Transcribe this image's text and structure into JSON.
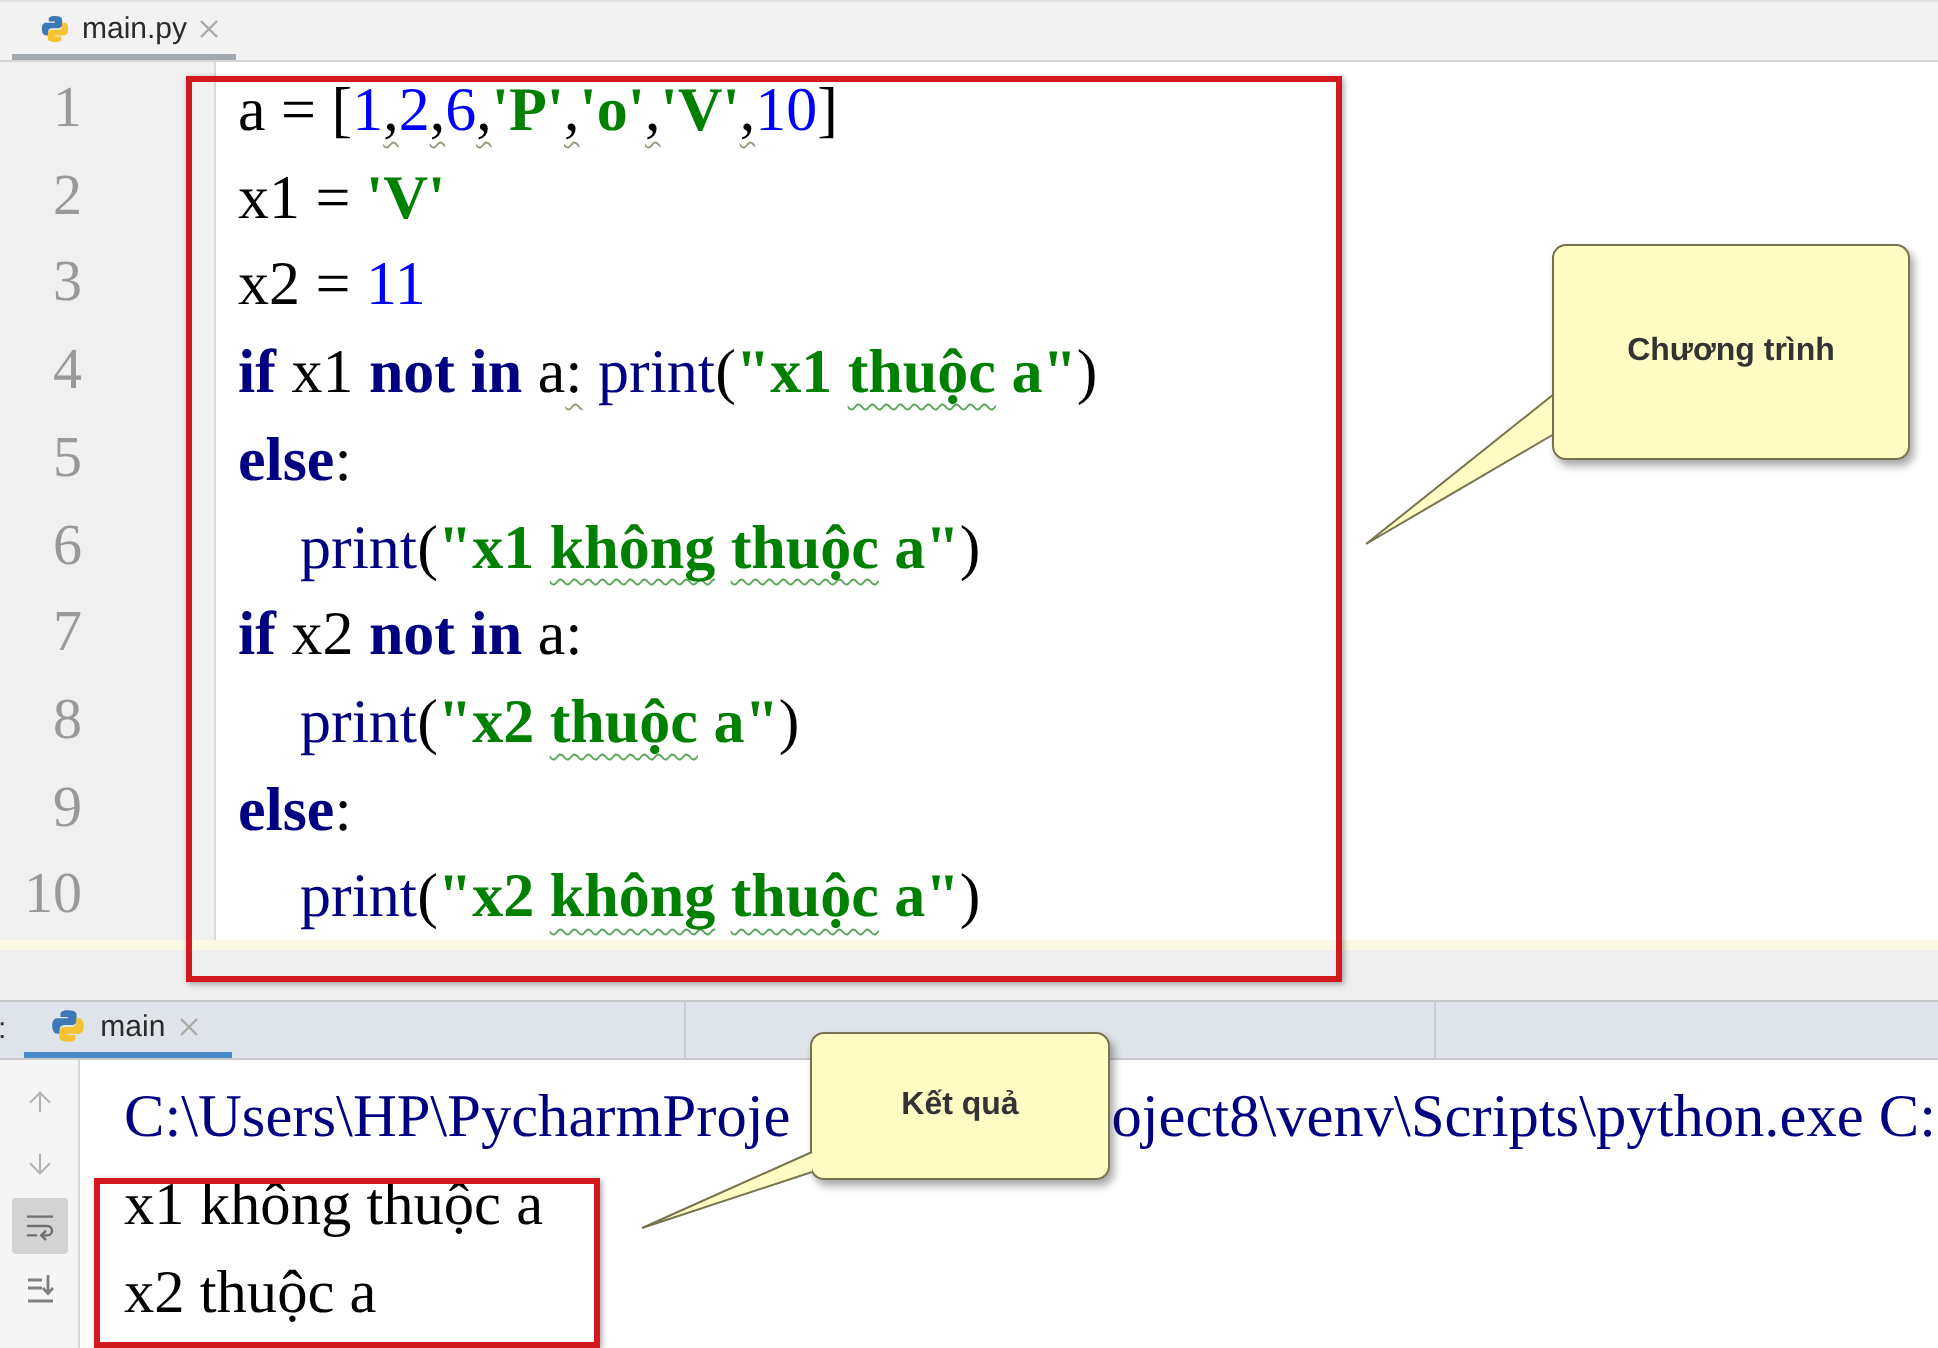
{
  "editor_tabs": [
    {
      "label": "main.py",
      "selected": true
    }
  ],
  "code_lines": [
    {
      "number": "1",
      "tokens": [
        {
          "kind": "plain",
          "text": "a = [",
          "flagged": false
        },
        {
          "kind": "number",
          "text": "1",
          "flagged": false
        },
        {
          "kind": "plain",
          "text": ",",
          "flagged": true
        },
        {
          "kind": "number",
          "text": "2",
          "flagged": false
        },
        {
          "kind": "plain",
          "text": ",",
          "flagged": true
        },
        {
          "kind": "number",
          "text": "6",
          "flagged": false
        },
        {
          "kind": "plain",
          "text": ",",
          "flagged": true
        },
        {
          "kind": "string",
          "text": "'P'",
          "flagged": false
        },
        {
          "kind": "plain",
          "text": ",",
          "flagged": true
        },
        {
          "kind": "string",
          "text": "'o'",
          "flagged": false
        },
        {
          "kind": "plain",
          "text": ",",
          "flagged": true
        },
        {
          "kind": "string",
          "text": "'V'",
          "flagged": false
        },
        {
          "kind": "plain",
          "text": ",",
          "flagged": true
        },
        {
          "kind": "number",
          "text": "10",
          "flagged": false
        },
        {
          "kind": "plain",
          "text": "]",
          "flagged": false
        }
      ]
    },
    {
      "number": "2",
      "tokens": [
        {
          "kind": "plain",
          "text": "x1 = ",
          "flagged": false
        },
        {
          "kind": "string",
          "text": "'V'",
          "flagged": false
        }
      ]
    },
    {
      "number": "3",
      "tokens": [
        {
          "kind": "plain",
          "text": "x2 = ",
          "flagged": false
        },
        {
          "kind": "number",
          "text": "11",
          "flagged": false
        }
      ]
    },
    {
      "number": "4",
      "tokens": [
        {
          "kind": "keyword",
          "text": "if",
          "flagged": false
        },
        {
          "kind": "plain",
          "text": " x1 ",
          "flagged": false
        },
        {
          "kind": "keyword",
          "text": "not in",
          "flagged": false
        },
        {
          "kind": "plain",
          "text": " a",
          "flagged": false
        },
        {
          "kind": "plain",
          "text": ": ",
          "flagged": true
        },
        {
          "kind": "builtin",
          "text": "print",
          "flagged": false
        },
        {
          "kind": "plain",
          "text": "(",
          "flagged": false
        },
        {
          "kind": "string",
          "text": "\"x1 ",
          "flagged": false
        },
        {
          "kind": "string",
          "text": "thuộc",
          "flagged": true
        },
        {
          "kind": "string",
          "text": " a\"",
          "flagged": false
        },
        {
          "kind": "plain",
          "text": ")",
          "flagged": false
        }
      ]
    },
    {
      "number": "5",
      "tokens": [
        {
          "kind": "keyword",
          "text": "else",
          "flagged": false
        },
        {
          "kind": "plain",
          "text": ":",
          "flagged": false
        }
      ]
    },
    {
      "number": "6",
      "tokens": [
        {
          "kind": "builtin",
          "text": "    print",
          "flagged": false
        },
        {
          "kind": "plain",
          "text": "(",
          "flagged": false
        },
        {
          "kind": "string",
          "text": "\"x1 ",
          "flagged": false
        },
        {
          "kind": "string",
          "text": "không",
          "flagged": true
        },
        {
          "kind": "string",
          "text": " thuộc",
          "flagged": true
        },
        {
          "kind": "string",
          "text": " a\"",
          "flagged": false
        },
        {
          "kind": "plain",
          "text": ")",
          "flagged": false
        }
      ]
    },
    {
      "number": "7",
      "tokens": [
        {
          "kind": "keyword",
          "text": "if",
          "flagged": false
        },
        {
          "kind": "plain",
          "text": " x2 ",
          "flagged": false
        },
        {
          "kind": "keyword",
          "text": "not in",
          "flagged": false
        },
        {
          "kind": "plain",
          "text": " a:",
          "flagged": false
        }
      ]
    },
    {
      "number": "8",
      "tokens": [
        {
          "kind": "builtin",
          "text": "    print",
          "flagged": false
        },
        {
          "kind": "plain",
          "text": "(",
          "flagged": false
        },
        {
          "kind": "string",
          "text": "\"x2 ",
          "flagged": false
        },
        {
          "kind": "string",
          "text": "thuộc",
          "flagged": true
        },
        {
          "kind": "string",
          "text": " a\"",
          "flagged": false
        },
        {
          "kind": "plain",
          "text": ")",
          "flagged": false
        }
      ]
    },
    {
      "number": "9",
      "tokens": [
        {
          "kind": "keyword",
          "text": "else",
          "flagged": false
        },
        {
          "kind": "plain",
          "text": ":",
          "flagged": false
        }
      ]
    },
    {
      "number": "10",
      "tokens": [
        {
          "kind": "builtin",
          "text": "    print",
          "flagged": false
        },
        {
          "kind": "plain",
          "text": "(",
          "flagged": false
        },
        {
          "kind": "string",
          "text": "\"x2 ",
          "flagged": false
        },
        {
          "kind": "string",
          "text": "không",
          "flagged": true
        },
        {
          "kind": "string",
          "text": " thuộc",
          "flagged": true
        },
        {
          "kind": "string",
          "text": " a\"",
          "flagged": false
        },
        {
          "kind": "plain",
          "text": ")",
          "flagged": false
        }
      ]
    }
  ],
  "run_panel": {
    "label": ":",
    "tabs": [
      {
        "label": "main",
        "selected": true
      }
    ],
    "soft_wrap": true,
    "lines": [
      {
        "kind": "command",
        "segments": [
          "C:\\Users\\HP\\PycharmProje",
          "oject8\\venv\\Scripts\\python.exe C:"
        ]
      },
      {
        "kind": "output",
        "segments": [
          "x1 không thuộc a"
        ]
      },
      {
        "kind": "output",
        "segments": [
          "x2 thuộc a"
        ]
      }
    ]
  },
  "callouts": [
    {
      "text": "Chương trình"
    },
    {
      "text": "Kết quả"
    }
  ]
}
